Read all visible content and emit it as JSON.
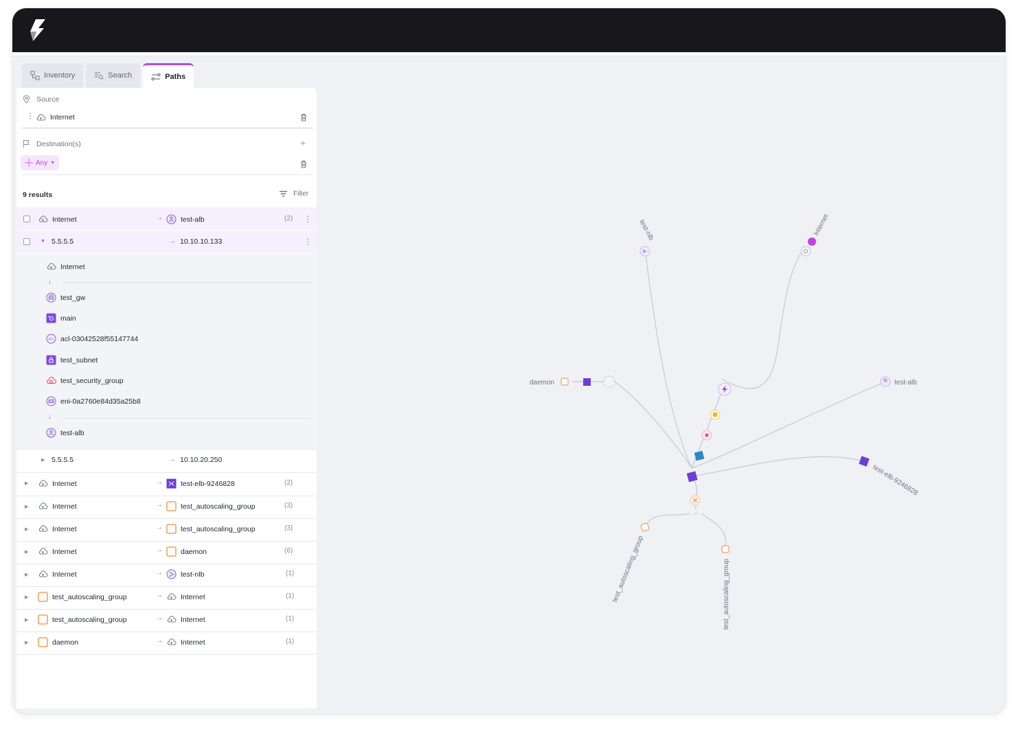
{
  "tabs": [
    {
      "label": "Inventory",
      "icon": "inventory-icon"
    },
    {
      "label": "Search",
      "icon": "search-icon"
    },
    {
      "label": "Paths",
      "icon": "paths-icon"
    }
  ],
  "source": {
    "heading": "Source",
    "value": "Internet"
  },
  "destinations": {
    "heading": "Destination(s)",
    "value": "Any"
  },
  "results": {
    "count_label": "9 results",
    "filter_label": "Filter"
  },
  "rows": [
    {
      "src": "Internet",
      "dst": "test-alb",
      "count": "(2)"
    },
    {
      "src": "5.5.5.5",
      "dst": "10.10.10.133"
    },
    {
      "src": "5.5.5.5",
      "dst": "10.10.20.250"
    },
    {
      "src": "Internet",
      "dst": "test-elb-9246828",
      "count": "(2)"
    },
    {
      "src": "Internet",
      "dst": "test_autoscaling_group",
      "count": "(3)"
    },
    {
      "src": "Internet",
      "dst": "test_autoscaling_group",
      "count": "(3)"
    },
    {
      "src": "Internet",
      "dst": "daemon",
      "count": "(6)"
    },
    {
      "src": "Internet",
      "dst": "test-nlb",
      "count": "(1)"
    },
    {
      "src": "test_autoscaling_group",
      "dst": "Internet",
      "count": "(1)"
    },
    {
      "src": "test_autoscaling_group",
      "dst": "Internet",
      "count": "(1)"
    },
    {
      "src": "daemon",
      "dst": "Internet",
      "count": "(1)"
    }
  ],
  "hops": [
    {
      "label": "Internet",
      "icon": "cloud-icon"
    },
    {
      "label": "test_gw",
      "icon": "gateway-icon"
    },
    {
      "label": "main",
      "icon": "route-table-icon"
    },
    {
      "label": "acl-03042528f55147744",
      "icon": "acl-icon"
    },
    {
      "label": "test_subnet",
      "icon": "subnet-icon"
    },
    {
      "label": "test_security_group",
      "icon": "security-group-icon"
    },
    {
      "label": "eni-0a2760e84d35a25b8",
      "icon": "eni-icon"
    },
    {
      "label": "test-alb",
      "icon": "load-balancer-icon"
    }
  ],
  "graph": {
    "labels": {
      "nlb": "test-nlb",
      "internet": "Internet",
      "daemon": "daemon",
      "alb": "test-alb",
      "elb": "test-elb-9246828",
      "asg1": "test_autoscaling_group",
      "asg2": "test_autoscaling_group"
    }
  },
  "colors": {
    "accent": "#b548e8",
    "selected_row": "#f6effd",
    "expanded_bg": "#f3f4f7",
    "topbar": "#17171c"
  }
}
